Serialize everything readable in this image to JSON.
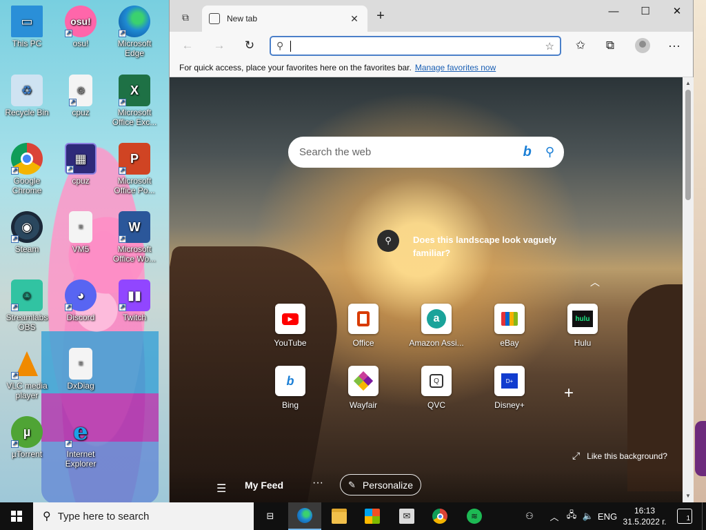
{
  "desktop": {
    "icons": [
      {
        "label": "This PC",
        "icon": "this-pc-icon",
        "color": "#2a8fd8"
      },
      {
        "label": "osu!",
        "icon": "osu-icon",
        "color": "#ff66aa"
      },
      {
        "label": "Microsoft Edge",
        "icon": "edge-icon",
        "color": "#1f8ad2"
      },
      {
        "label": "Recycle Bin",
        "icon": "recycle-bin-icon",
        "color": "#8fb7d9"
      },
      {
        "label": "cpuz",
        "icon": "file-icon",
        "color": "#e8e8e8"
      },
      {
        "label": "Microsoft Office Exc...",
        "icon": "excel-icon",
        "color": "#1e7145"
      },
      {
        "label": "Google Chrome",
        "icon": "chrome-icon",
        "color": "#db4437"
      },
      {
        "label": "cpuz",
        "icon": "cpuz-icon",
        "color": "#2e2a7a"
      },
      {
        "label": "Microsoft Office Po...",
        "icon": "powerpoint-icon",
        "color": "#d04423"
      },
      {
        "label": "Steam",
        "icon": "steam-icon",
        "color": "#1b2838"
      },
      {
        "label": "VM5",
        "icon": "file-icon",
        "color": "#e8e8e8"
      },
      {
        "label": "Microsoft Office Wo...",
        "icon": "word-icon",
        "color": "#2b579a"
      },
      {
        "label": "Streamlabs OBS",
        "icon": "streamlabs-icon",
        "color": "#31c3a2"
      },
      {
        "label": "Discord",
        "icon": "discord-icon",
        "color": "#5865f2"
      },
      {
        "label": "Twitch",
        "icon": "twitch-icon",
        "color": "#9146ff"
      },
      {
        "label": "VLC media player",
        "icon": "vlc-icon",
        "color": "#f08a00"
      },
      {
        "label": "DxDiag",
        "icon": "file-icon",
        "color": "#e8e8e8"
      },
      {
        "label": "µTorrent",
        "icon": "utorrent-icon",
        "color": "#4fa435"
      },
      {
        "label": "Internet Explorer",
        "icon": "internet-explorer-icon",
        "color": "#1ea0e6"
      }
    ]
  },
  "browser": {
    "tab_title": "New tab",
    "address_value": "",
    "favorites_bar": {
      "message": "For quick access, place your favorites here on the favorites bar.",
      "link": "Manage favorites now"
    },
    "ntp": {
      "search_placeholder": "Search the web",
      "bing_glyph": "b",
      "bg_question": "Does this landscape look vaguely familiar?",
      "like_background": "Like this background?",
      "my_feed": "My Feed",
      "personalize": "Personalize",
      "tiles": [
        {
          "label": "YouTube",
          "icon": "youtube-icon",
          "color": "#ff0000"
        },
        {
          "label": "Office",
          "icon": "office-icon",
          "color": "#d83b01"
        },
        {
          "label": "Amazon Assi...",
          "icon": "amazon-assistant-icon",
          "color": "#1aa39a"
        },
        {
          "label": "eBay",
          "icon": "ebay-icon",
          "color": "#e53238"
        },
        {
          "label": "Hulu",
          "icon": "hulu-icon",
          "color": "#1ce783"
        },
        {
          "label": "Bing",
          "icon": "bing-icon",
          "color": "#1b7fd6"
        },
        {
          "label": "Wayfair",
          "icon": "wayfair-icon",
          "color": "#7b189f"
        },
        {
          "label": "QVC",
          "icon": "qvc-icon",
          "color": "#333333"
        },
        {
          "label": "Disney+",
          "icon": "disney-plus-icon",
          "color": "#113ccf"
        }
      ]
    }
  },
  "taskbar": {
    "search_placeholder": "Type here to search",
    "language": "ENG",
    "time": "16:13",
    "date": "31.5.2022 г.",
    "notification_count": "1",
    "pinned": [
      {
        "icon": "task-view-icon",
        "color": "#101010"
      },
      {
        "icon": "edge-icon",
        "color": "#1f8ad2",
        "active": true
      },
      {
        "icon": "file-explorer-icon",
        "color": "#f2c04b"
      },
      {
        "icon": "microsoft-store-icon",
        "color": "#2f6bd0"
      },
      {
        "icon": "mail-icon",
        "color": "#dcdcdc"
      },
      {
        "icon": "chrome-icon",
        "color": "#db4437"
      },
      {
        "icon": "spotify-icon",
        "color": "#1db954"
      }
    ]
  }
}
